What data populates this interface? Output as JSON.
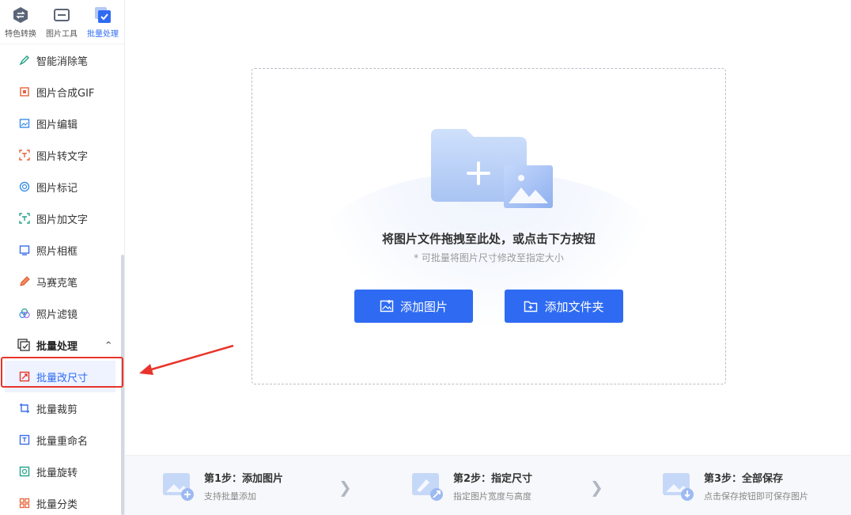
{
  "top_tabs": [
    {
      "label": "特色转换",
      "icon": "swap-icon"
    },
    {
      "label": "图片工具",
      "icon": "image-tool-icon"
    },
    {
      "label": "批量处理",
      "icon": "batch-check-icon",
      "active": true
    }
  ],
  "menu": {
    "items": [
      {
        "label": "智能消除笔",
        "icon": "pen-icon"
      },
      {
        "label": "图片合成GIF",
        "icon": "gif-icon"
      },
      {
        "label": "图片编辑",
        "icon": "edit-image-icon"
      },
      {
        "label": "图片转文字",
        "icon": "ocr-icon"
      },
      {
        "label": "图片标记",
        "icon": "mark-icon"
      },
      {
        "label": "图片加文字",
        "icon": "add-text-icon"
      },
      {
        "label": "照片相框",
        "icon": "frame-icon"
      },
      {
        "label": "马赛克笔",
        "icon": "mosaic-pen-icon"
      },
      {
        "label": "照片滤镜",
        "icon": "filter-icon"
      }
    ],
    "group": {
      "label": "批量处理",
      "icon": "batch-icon",
      "chevron": "^"
    },
    "group_items": [
      {
        "label": "批量改尺寸",
        "icon": "resize-icon",
        "selected": true
      },
      {
        "label": "批量裁剪",
        "icon": "crop-icon"
      },
      {
        "label": "批量重命名",
        "icon": "rename-icon"
      },
      {
        "label": "批量旋转",
        "icon": "rotate-icon"
      },
      {
        "label": "批量分类",
        "icon": "classify-icon"
      }
    ]
  },
  "dropzone": {
    "title": "将图片文件拖拽至此处，或点击下方按钮",
    "subtitle": "* 可批量将图片尺寸修改至指定大小",
    "add_image_label": "添加图片",
    "add_folder_label": "添加文件夹"
  },
  "steps": [
    {
      "title": "第1步：添加图片",
      "desc": "支持批量添加"
    },
    {
      "title": "第2步：指定尺寸",
      "desc": "指定图片宽度与高度"
    },
    {
      "title": "第3步：全部保存",
      "desc": "点击保存按钮即可保存图片"
    }
  ],
  "colors": {
    "accent": "#2f6bf2",
    "annotation": "#e8342a"
  }
}
